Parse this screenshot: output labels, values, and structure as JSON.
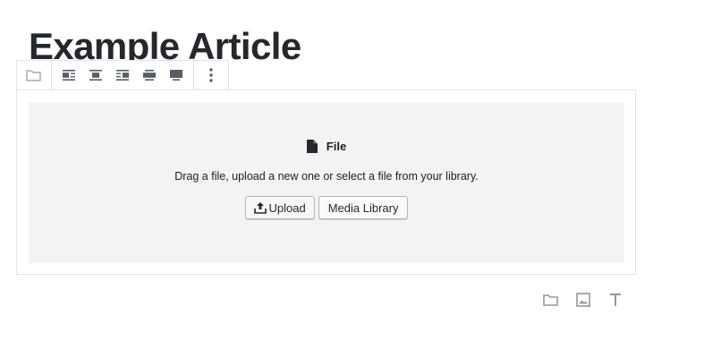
{
  "article": {
    "title": "Example Article"
  },
  "toolbar": {
    "groups": [
      {
        "items": [
          {
            "icon": "folder-icon"
          }
        ]
      },
      {
        "items": [
          {
            "icon": "align-left-icon"
          },
          {
            "icon": "align-center-icon"
          },
          {
            "icon": "align-right-icon"
          },
          {
            "icon": "align-wide-icon"
          },
          {
            "icon": "align-full-icon"
          }
        ]
      },
      {
        "items": [
          {
            "icon": "more-options-icon"
          }
        ]
      }
    ]
  },
  "file_block": {
    "label": "File",
    "label_icon": "file-icon",
    "instructions": "Drag a file, upload a new one or select a file from your library.",
    "upload_label": "Upload",
    "upload_icon": "upload-icon",
    "media_library_label": "Media Library"
  },
  "inserter": {
    "items": [
      {
        "icon": "folder-icon"
      },
      {
        "icon": "image-icon"
      },
      {
        "icon": "text-icon"
      }
    ]
  },
  "colors": {
    "title": "#23282d",
    "border": "#e2e4e7",
    "placeholder_bg": "#f3f3f3",
    "icon_gray": "#555d66",
    "inserter_gray": "#8f98a1"
  }
}
